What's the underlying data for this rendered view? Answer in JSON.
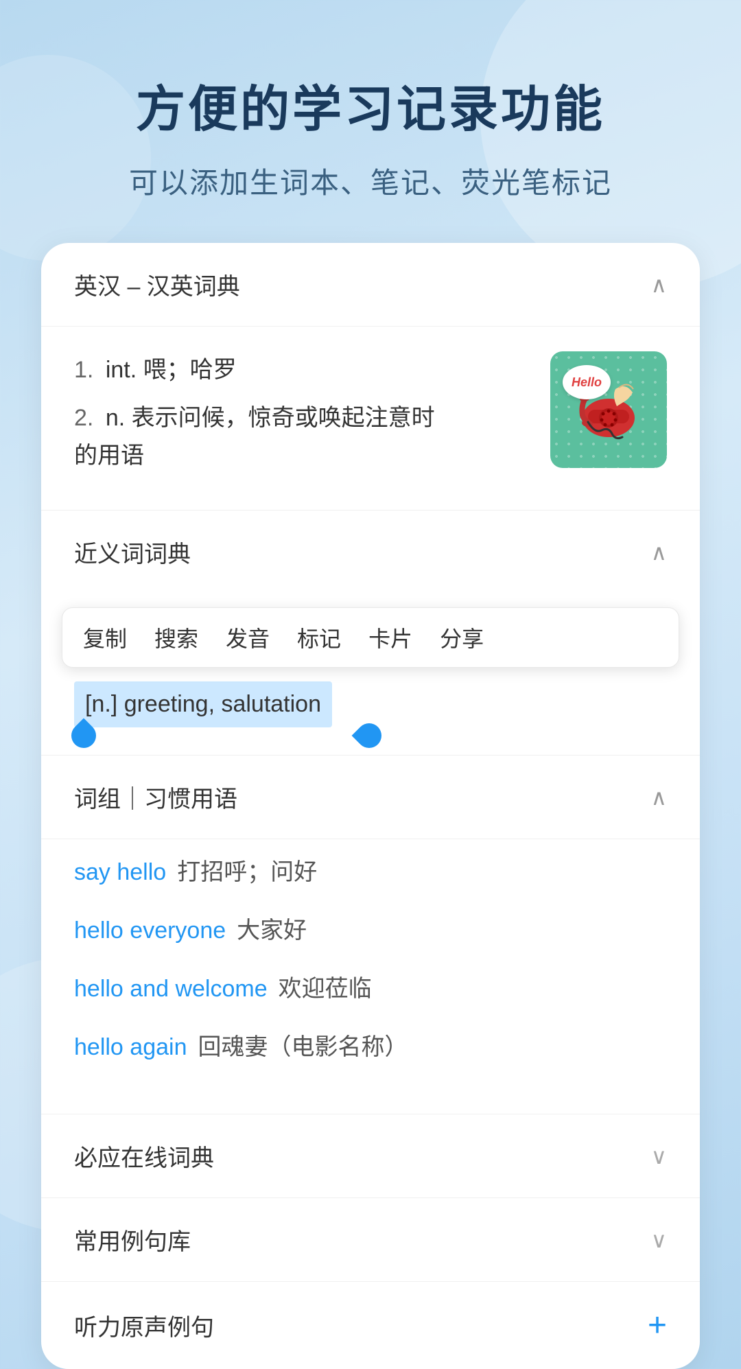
{
  "header": {
    "main_title": "方便的学习记录功能",
    "subtitle": "可以添加生词本、笔记、荧光笔标记"
  },
  "dictionary_section": {
    "title": "英汉 – 汉英词典",
    "chevron": "∧",
    "definitions": [
      {
        "number": "1.",
        "part_of_speech": "int.",
        "text": "喂；哈罗"
      },
      {
        "number": "2.",
        "part_of_speech": "n.",
        "text": "表示问候，惊奇或唤起注意时的用语"
      }
    ],
    "image_alt": "hello telephone illustration",
    "image_bubble_text": "Hello"
  },
  "synonyms_section": {
    "title": "近义词词典",
    "chevron": "∧",
    "context_menu_items": [
      "复制",
      "搜索",
      "发音",
      "标记",
      "卡片",
      "分享"
    ],
    "selected_text": "[n.] greeting, salutation"
  },
  "phrases_section": {
    "title": "词组｜习惯用语",
    "chevron": "∧",
    "phrases": [
      {
        "english": "say hello",
        "chinese": "打招呼；问好"
      },
      {
        "english": "hello everyone",
        "chinese": "大家好"
      },
      {
        "english": "hello and welcome",
        "chinese": "欢迎莅临"
      },
      {
        "english": "hello again",
        "chinese": "回魂妻（电影名称）"
      }
    ]
  },
  "collapsed_sections": [
    {
      "title": "必应在线词典",
      "icon": "chevron_down"
    },
    {
      "title": "常用例句库",
      "icon": "chevron_down"
    },
    {
      "title": "听力原声例句",
      "icon": "plus"
    }
  ]
}
